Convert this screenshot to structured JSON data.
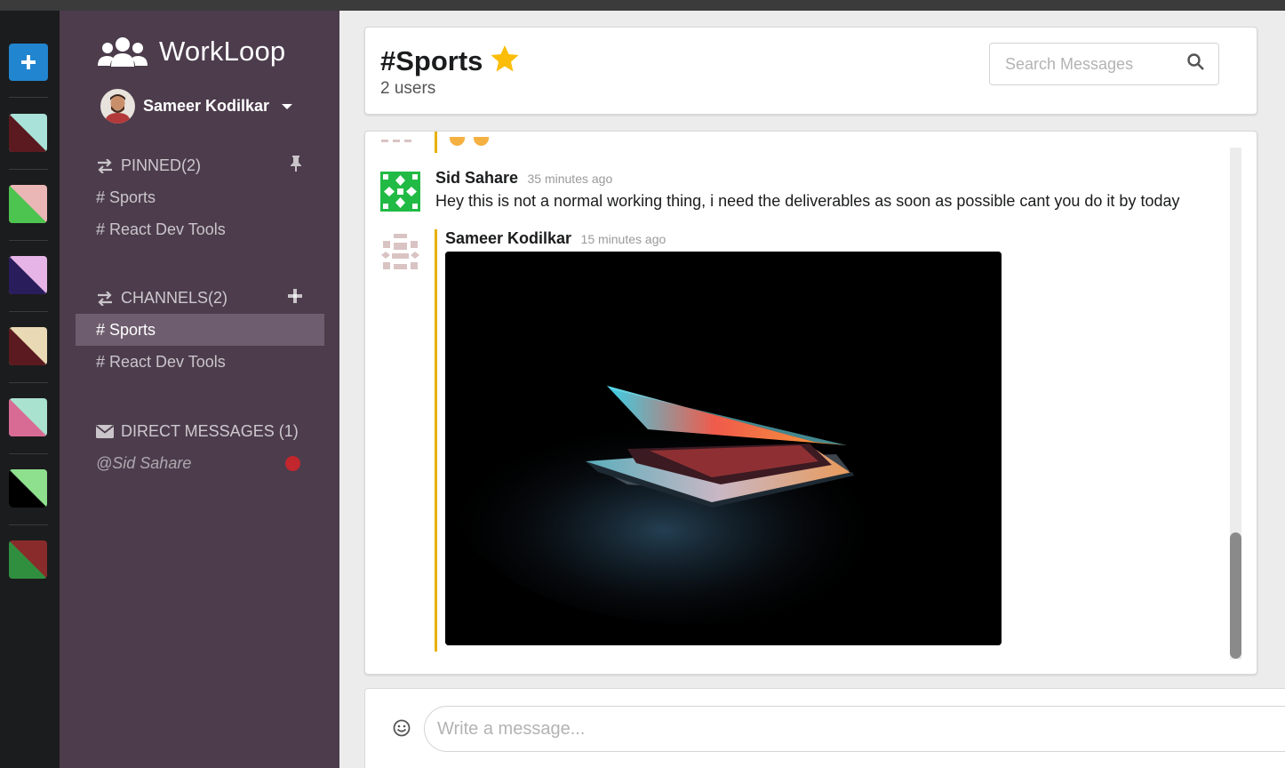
{
  "app": {
    "name": "WorkLoop",
    "logo_icon": "users-icon"
  },
  "rail": {
    "add_icon": "plus-icon",
    "swatches": [
      {
        "primary": "#a9e2d8",
        "secondary": "#5a1a1f"
      },
      {
        "primary": "#ebb6b6",
        "secondary": "#4cc44f"
      },
      {
        "primary": "#e6b4e6",
        "secondary": "#2a1d5c"
      },
      {
        "primary": "#e9d9b4",
        "secondary": "#5a1a1f"
      },
      {
        "primary": "#a9e2cf",
        "secondary": "#d86b93"
      },
      {
        "primary": "#8ee08e",
        "secondary": "#000000"
      },
      {
        "primary": "#8a2b2b",
        "secondary": "#2f8f3f"
      }
    ]
  },
  "user": {
    "name": "Sameer Kodilkar"
  },
  "sidebar": {
    "pinned": {
      "label": "PINNED(2)",
      "icon": "thumbtack-icon",
      "items": [
        "# Sports",
        "# React Dev Tools"
      ]
    },
    "channels": {
      "label": "CHANNELS(2)",
      "icon": "plus-icon",
      "items": [
        "# Sports",
        "# React Dev Tools"
      ],
      "active_index": 0
    },
    "direct_messages": {
      "label": "DIRECT MESSAGES (1)",
      "icon": "mail-icon",
      "items": [
        {
          "label": "@Sid Sahare",
          "status_color": "#c1272d"
        }
      ]
    }
  },
  "header": {
    "channel_name": "#Sports",
    "starred": true,
    "user_count": "2 users",
    "search_placeholder": "Search Messages"
  },
  "messages": [
    {
      "author": "Sid Sahare",
      "time": "35 minutes ago",
      "text": "Hey this is not a normal working thing, i need the deliverables as soon as possible cant you do it by today",
      "avatar_color": "#21ba45"
    },
    {
      "author": "Sameer Kodilkar",
      "time": "15 minutes ago",
      "has_image": true,
      "avatar_color": "#d9c3c3"
    }
  ],
  "composer": {
    "placeholder": "Write a message..."
  },
  "colors": {
    "sidebar_bg": "#4c3c4c",
    "rail_bg": "#1b1c1d",
    "active_item_bg": "#6e5d6e",
    "accent_blue": "#2185d0",
    "thread_bar": "#e8b000",
    "star": "#fbbd08"
  }
}
